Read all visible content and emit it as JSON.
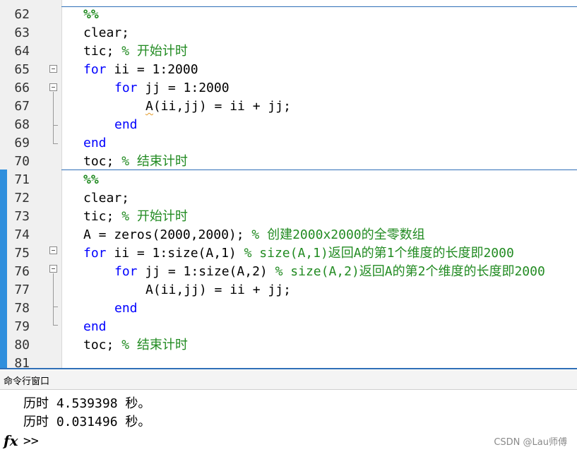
{
  "editor": {
    "lines": [
      {
        "num": "62",
        "indent": 0,
        "tokens": [
          {
            "t": "%%",
            "c": "cm-bold"
          }
        ]
      },
      {
        "num": "63",
        "indent": 0,
        "tokens": [
          {
            "t": "clear;",
            "c": ""
          }
        ]
      },
      {
        "num": "64",
        "indent": 0,
        "tokens": [
          {
            "t": "tic; ",
            "c": ""
          },
          {
            "t": "% 开始计时",
            "c": "cm"
          }
        ]
      },
      {
        "num": "65",
        "indent": 0,
        "tokens": [
          {
            "t": "for",
            "c": "kw"
          },
          {
            "t": " ii = 1:2000",
            "c": ""
          }
        ]
      },
      {
        "num": "66",
        "indent": 1,
        "tokens": [
          {
            "t": "for",
            "c": "kw"
          },
          {
            "t": " jj = 1:2000",
            "c": ""
          }
        ]
      },
      {
        "num": "67",
        "indent": 2,
        "tokens": [
          {
            "t": "A",
            "c": "wavy"
          },
          {
            "t": "(ii,jj) = ii + jj;",
            "c": ""
          }
        ]
      },
      {
        "num": "68",
        "indent": 1,
        "tokens": [
          {
            "t": "end",
            "c": "kw"
          }
        ]
      },
      {
        "num": "69",
        "indent": 0,
        "tokens": [
          {
            "t": "end",
            "c": "kw"
          }
        ]
      },
      {
        "num": "70",
        "indent": 0,
        "tokens": [
          {
            "t": "toc; ",
            "c": ""
          },
          {
            "t": "% 结束计时",
            "c": "cm"
          }
        ]
      },
      {
        "num": "71",
        "indent": 0,
        "tokens": [
          {
            "t": "%%",
            "c": "cm-bold"
          }
        ]
      },
      {
        "num": "72",
        "indent": 0,
        "tokens": [
          {
            "t": "clear;",
            "c": ""
          }
        ]
      },
      {
        "num": "73",
        "indent": 0,
        "tokens": [
          {
            "t": "tic; ",
            "c": ""
          },
          {
            "t": "% 开始计时",
            "c": "cm"
          }
        ]
      },
      {
        "num": "74",
        "indent": 0,
        "tokens": [
          {
            "t": "A = zeros(2000,2000); ",
            "c": ""
          },
          {
            "t": "% 创建2000x2000的全零数组",
            "c": "cm"
          }
        ]
      },
      {
        "num": "75",
        "indent": 0,
        "tokens": [
          {
            "t": "for",
            "c": "kw"
          },
          {
            "t": " ii = 1:size(A,1) ",
            "c": ""
          },
          {
            "t": "% size(A,1)返回A的第1个维度的长度即2000",
            "c": "cm"
          }
        ]
      },
      {
        "num": "76",
        "indent": 1,
        "tokens": [
          {
            "t": "for",
            "c": "kw"
          },
          {
            "t": " jj = 1:size(A,2) ",
            "c": ""
          },
          {
            "t": "% size(A,2)返回A的第2个维度的长度即2000",
            "c": "cm"
          }
        ]
      },
      {
        "num": "77",
        "indent": 2,
        "tokens": [
          {
            "t": "A(ii,jj) = ii + jj;",
            "c": ""
          }
        ]
      },
      {
        "num": "78",
        "indent": 1,
        "tokens": [
          {
            "t": "end",
            "c": "kw"
          }
        ]
      },
      {
        "num": "79",
        "indent": 0,
        "tokens": [
          {
            "t": "end",
            "c": "kw"
          }
        ]
      },
      {
        "num": "80",
        "indent": 0,
        "tokens": [
          {
            "t": "toc; ",
            "c": ""
          },
          {
            "t": "% 结束计时",
            "c": "cm"
          }
        ]
      },
      {
        "num": "81",
        "indent": 0,
        "tokens": []
      }
    ]
  },
  "command_window": {
    "title": "命令行窗口",
    "outputs": [
      "历时 4.539398 秒。",
      "历时 0.031496 秒。"
    ],
    "fx_label": "fx",
    "prompt": ">>"
  },
  "watermark": "CSDN @Lau师傅",
  "colors": {
    "keyword": "#0000ff",
    "comment": "#228b22",
    "cell_bar": "#2f8fdd",
    "cell_divider": "#2f6fb7"
  }
}
